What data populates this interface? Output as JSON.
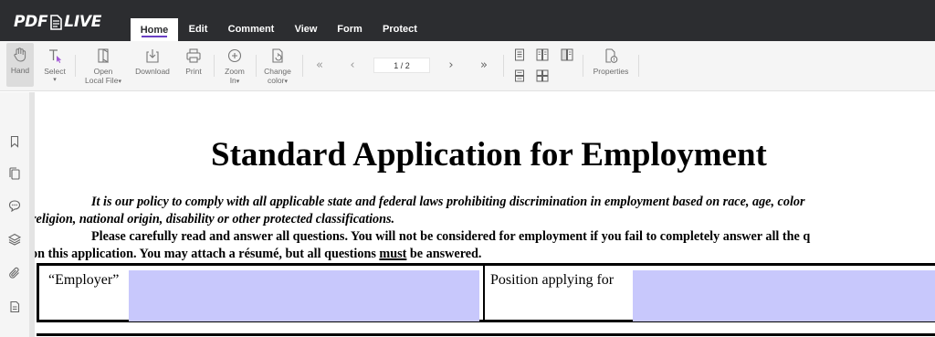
{
  "app": {
    "logo_left": "PDF",
    "logo_right": "LIVE"
  },
  "menu": {
    "tabs": [
      {
        "label": "Home",
        "active": true
      },
      {
        "label": "Edit",
        "active": false
      },
      {
        "label": "Comment",
        "active": false
      },
      {
        "label": "View",
        "active": false
      },
      {
        "label": "Form",
        "active": false
      },
      {
        "label": "Protect",
        "active": false
      }
    ]
  },
  "toolbar": {
    "hand": "Hand",
    "select": "Select",
    "open_line1": "Open",
    "open_line2": "Local File",
    "download": "Download",
    "print": "Print",
    "zoom_line1": "Zoom",
    "zoom_line2": "In",
    "color_line1": "Change",
    "color_line2": "color",
    "page_value": "1 / 2",
    "properties": "Properties",
    "caret": "▾"
  },
  "sidebar": {
    "icons": [
      "bookmark-icon",
      "pages-icon",
      "comments-icon",
      "layers-icon",
      "attachments-icon",
      "form-fields-icon"
    ]
  },
  "document": {
    "title": "Standard Application for Employment",
    "policy_line1": "It is our policy to comply with all applicable state and federal laws prohibiting discrimination in employment based on race, age, color",
    "policy_line2": "religion, national origin, disability or other protected classifications.",
    "instructions_line1": "Please carefully read and answer all questions. You will not be considered for employment if you fail to completely answer all the q",
    "instructions_line2_a": "on this application. You may attach a résumé, but all questions ",
    "instructions_line2_b": "must",
    "instructions_line2_c": " be answered.",
    "employer_label": "“Employer”",
    "position_label": "Position applying for",
    "employer_value": "",
    "position_value": ""
  },
  "colors": {
    "topbar": "#2c2d30",
    "accent": "#6a3fc3",
    "field_fill": "#c8c8fc"
  }
}
